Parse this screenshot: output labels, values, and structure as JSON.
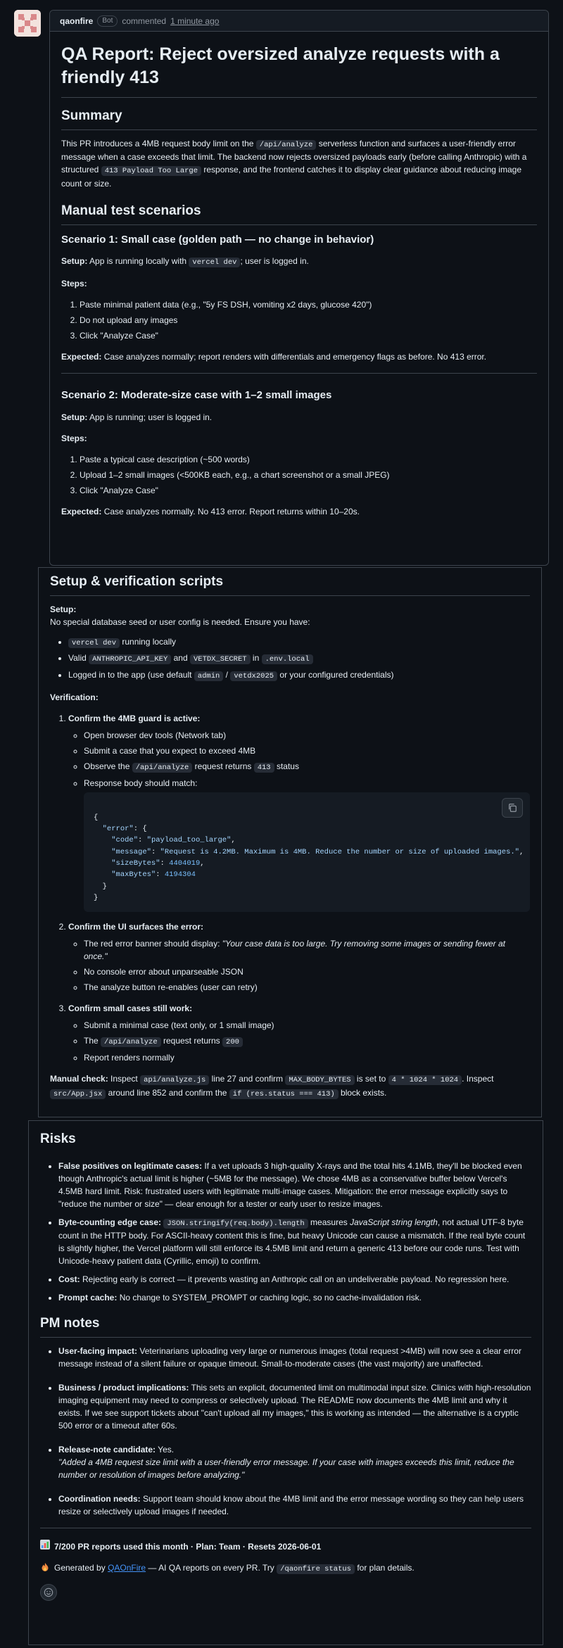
{
  "comment": {
    "author": "qaonfire",
    "badge": "Bot",
    "action": "commented",
    "time": "1 minute ago"
  },
  "title": "QA Report: Reject oversized analyze requests with a friendly 413",
  "summary": {
    "heading": "Summary",
    "p1": "This PR introduces a 4MB request body limit on the ",
    "code1": "/api/analyze",
    "p2": " serverless function and surfaces a user-friendly error message when a case exceeds that limit. The backend now rejects oversized payloads early (before calling Anthropic) with a structured ",
    "code2": "413 Payload Too Large",
    "p3": " response, and the frontend catches it to display clear guidance about reducing image count or size."
  },
  "manual": {
    "heading": "Manual test scenarios",
    "s1": {
      "title": "Scenario 1: Small case (golden path — no change in behavior)",
      "setup_label": "Setup:",
      "setup_a": " App is running locally with ",
      "setup_code": "vercel dev",
      "setup_b": "; user is logged in.",
      "steps_label": "Steps:",
      "steps": [
        "Paste minimal patient data (e.g., \"5y FS DSH, vomiting x2 days, glucose 420\")",
        "Do not upload any images",
        "Click \"Analyze Case\""
      ],
      "expected_label": "Expected:",
      "expected": " Case analyzes normally; report renders with differentials and emergency flags as before. No 413 error."
    },
    "s2": {
      "title": "Scenario 2: Moderate-size case with 1–2 small images",
      "setup_label": "Setup:",
      "setup": " App is running; user is logged in.",
      "steps_label": "Steps:",
      "steps": [
        "Paste a typical case description (~500 words)",
        "Upload 1–2 small images (<500KB each, e.g., a chart screenshot or a small JPEG)",
        "Click \"Analyze Case\""
      ],
      "expected_label": "Expected:",
      "expected": " Case analyzes normally. No 413 error. Report returns within 10–20s."
    }
  },
  "setup": {
    "heading": "Setup & verification scripts",
    "setup_label": "Setup:",
    "setup_text": "No special database seed or user config is needed. Ensure you have:",
    "b1_code": "vercel dev",
    "b1_text": " running locally",
    "b2_a": "Valid ",
    "b2_code1": "ANTHROPIC_API_KEY",
    "b2_b": " and ",
    "b2_code2": "VETDX_SECRET",
    "b2_c": " in ",
    "b2_code3": ".env.local",
    "b3_a": "Logged in to the app (use default ",
    "b3_code1": "admin",
    "b3_b": " / ",
    "b3_code2": "vetdx2025",
    "b3_c": " or your configured credentials)",
    "verification_label": "Verification:",
    "v1_title": "Confirm the 4MB guard is active:",
    "v1_items": [
      "Open browser dev tools (Network tab)",
      "Submit a case that you expect to exceed 4MB"
    ],
    "v1_i3_a": "Observe the ",
    "v1_i3_code": "/api/analyze",
    "v1_i3_b": " request returns ",
    "v1_i3_code2": "413",
    "v1_i3_c": " status",
    "v1_i4": "Response body should match:",
    "json": {
      "k_error": "\"error\"",
      "k_code": "\"code\"",
      "v_code": "\"payload_too_large\"",
      "k_message": "\"message\"",
      "v_message": "\"Request is 4.2MB. Maximum is 4MB. Reduce the number or size of uploaded images.\"",
      "k_size": "\"sizeBytes\"",
      "v_size": "4404019",
      "k_max": "\"maxBytes\"",
      "v_max": "4194304"
    },
    "v2_title": "Confirm the UI surfaces the error:",
    "v2_i1_a": "The red error banner should display: ",
    "v2_i1_em": "\"Your case data is too large. Try removing some images or sending fewer at once.\"",
    "v2_i2": "No console error about unparseable JSON",
    "v2_i3": "The analyze button re-enables (user can retry)",
    "v3_title": "Confirm small cases still work:",
    "v3_i1": "Submit a minimal case (text only, or 1 small image)",
    "v3_i2_a": "The ",
    "v3_i2_code": "/api/analyze",
    "v3_i2_b": " request returns ",
    "v3_i2_code2": "200",
    "v3_i3": "Report renders normally",
    "mc_label": "Manual check:",
    "mc_a": " Inspect ",
    "mc_code1": "api/analyze.js",
    "mc_b": " line 27 and confirm ",
    "mc_code2": "MAX_BODY_BYTES",
    "mc_c": " is set to ",
    "mc_code3": "4 * 1024 * 1024",
    "mc_d": ". Inspect ",
    "mc_code4": "src/App.jsx",
    "mc_e": " around line 852 and confirm the ",
    "mc_code5": "if (res.status === 413)",
    "mc_f": " block exists."
  },
  "risks": {
    "heading": "Risks",
    "r1_label": "False positives on legitimate cases:",
    "r1_text": " If a vet uploads 3 high-quality X-rays and the total hits 4.1MB, they'll be blocked even though Anthropic's actual limit is higher (~5MB for the message). We chose 4MB as a conservative buffer below Vercel's 4.5MB hard limit. Risk: frustrated users with legitimate multi-image cases. Mitigation: the error message explicitly says to \"reduce the number or size\" — clear enough for a tester or early user to resize images.",
    "r2_label": "Byte-counting edge case:",
    "r2_code": "JSON.stringify(req.body).length",
    "r2_a": " measures ",
    "r2_em": "JavaScript string length",
    "r2_b": ", not actual UTF-8 byte count in the HTTP body. For ASCII-heavy content this is fine, but heavy Unicode can cause a mismatch. If the real byte count is slightly higher, the Vercel platform will still enforce its 4.5MB limit and return a generic 413 before our code runs. Test with Unicode-heavy patient data (Cyrillic, emoji) to confirm.",
    "r3_label": "Cost:",
    "r3_text": " Rejecting early is correct — it prevents wasting an Anthropic call on an undeliverable payload. No regression here.",
    "r4_label": "Prompt cache:",
    "r4_text": " No change to SYSTEM_PROMPT or caching logic, so no cache-invalidation risk."
  },
  "pm": {
    "heading": "PM notes",
    "p1_label": "User-facing impact:",
    "p1_text": " Veterinarians uploading very large or numerous images (total request >4MB) will now see a clear error message instead of a silent failure or opaque timeout. Small-to-moderate cases (the vast majority) are unaffected.",
    "p2_label": "Business / product implications:",
    "p2_text": " This sets an explicit, documented limit on multimodal input size. Clinics with high-resolution imaging equipment may need to compress or selectively upload. The README now documents the 4MB limit and why it exists. If we see support tickets about \"can't upload all my images,\" this is working as intended — the alternative is a cryptic 500 error or a timeout after 60s.",
    "p3_label": "Release-note candidate:",
    "p3_text": " Yes.",
    "p3_em": "\"Added a 4MB request size limit with a user-friendly error message. If your case with images exceeds this limit, reduce the number or resolution of images before analyzing.\"",
    "p4_label": "Coordination needs:",
    "p4_text": " Support team should know about the 4MB limit and the error message wording so they can help users resize or selectively upload images if needed."
  },
  "footer": {
    "usage": "7/200 PR reports used this month · Plan: Team · Resets 2026-06-01",
    "gen_a": "Generated by ",
    "gen_link": "QAOnFire",
    "gen_b": " — AI QA reports on every PR. Try ",
    "gen_code": "/qaonfire status",
    "gen_c": " for plan details."
  },
  "colors": {
    "bg": "#0d1117",
    "border": "#3d444d",
    "text": "#e6edf3",
    "muted": "#9198a1",
    "link": "#4493f8"
  }
}
